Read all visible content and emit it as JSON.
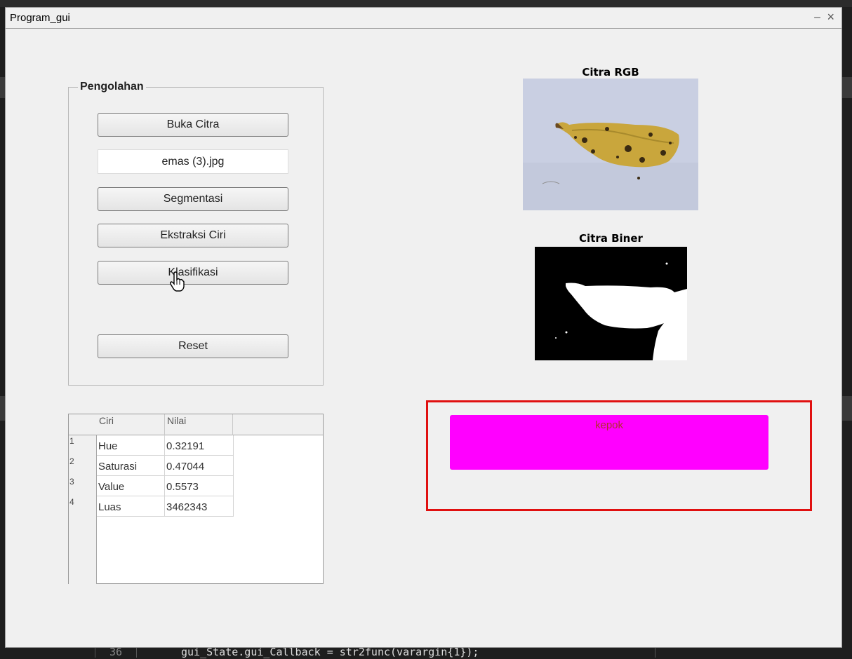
{
  "window": {
    "title": "Program_gui"
  },
  "panel": {
    "title": "Pengolahan",
    "buttons": {
      "open": "Buka Citra",
      "segment": "Segmentasi",
      "extract": "Ekstraksi Ciri",
      "classify": "Klasifikasi",
      "reset": "Reset"
    },
    "filename": "emas (3).jpg"
  },
  "table": {
    "headers": [
      "Ciri",
      "Nilai"
    ],
    "rows": [
      {
        "num": "1",
        "ciri": "Hue",
        "nilai": "0.32191"
      },
      {
        "num": "2",
        "ciri": "Saturasi",
        "nilai": "0.47044"
      },
      {
        "num": "3",
        "ciri": "Value",
        "nilai": "0.5573"
      },
      {
        "num": "4",
        "ciri": "Luas",
        "nilai": "3462343"
      }
    ]
  },
  "images": {
    "rgb_title": "Citra RGB",
    "binary_title": "Citra Biner"
  },
  "result": {
    "label": "kepok",
    "color": "#ff00ff",
    "frame_color": "#e01010"
  },
  "background": {
    "line_number": "36",
    "code_line": "gui_State.gui_Callback = str2func(varargin{1});"
  }
}
